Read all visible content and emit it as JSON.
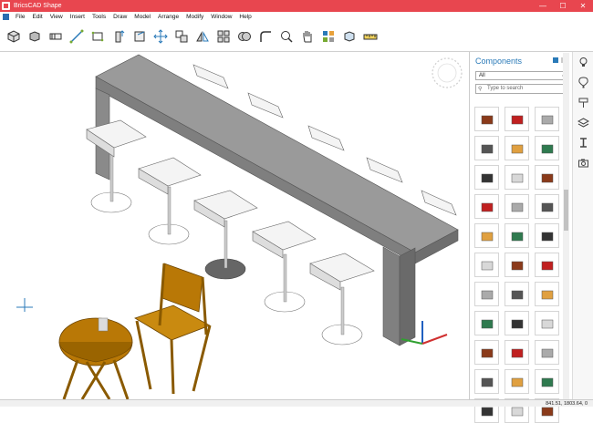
{
  "window": {
    "title": "BricsCAD Shape",
    "minimize": "—",
    "maximize": "☐",
    "close": "✕"
  },
  "menu": [
    "File",
    "Edit",
    "View",
    "Insert",
    "Tools",
    "Draw",
    "Model",
    "Arrange",
    "Modify",
    "Window",
    "Help"
  ],
  "toolbar": {
    "tools": [
      "box-icon",
      "solid-icon",
      "extrude-icon",
      "line-icon",
      "rectangle-icon",
      "push-pull-icon",
      "section-icon",
      "move-icon",
      "copy-icon",
      "mirror-icon",
      "array-icon",
      "union-icon",
      "fillet-icon",
      "zoom-icon",
      "pan-icon",
      "materials-icon",
      "render-icon",
      "measure-icon"
    ]
  },
  "components_panel": {
    "title": "Components",
    "filter_value": "All",
    "search_placeholder": "Type to search",
    "items": [
      "table-item",
      "stove-item",
      "desk-item",
      "office-chair-item",
      "cabinet-item",
      "glass-table-item",
      "bench-item",
      "round-table-item",
      "bed-item",
      "sofa-item",
      "fire-extinguisher-item",
      "clock-item",
      "chair-item",
      "shelf-item",
      "crate-item",
      "lamp-item",
      "kitchen-item",
      "drawer-item",
      "beam-item",
      "wall-item",
      "sideboard-item",
      "frame-item",
      "nightstand-item",
      "laptop-item",
      "board-item",
      "piano-item",
      "pool-table-item",
      "locker-item",
      "sign-item",
      "rug-item",
      "hand-item",
      "lamp2-item",
      "bowl-item"
    ]
  },
  "right_sidebar": [
    "light-bulb-icon",
    "hot-air-balloon-icon",
    "paint-roller-icon",
    "layers-icon",
    "i-beam-icon",
    "camera-icon"
  ],
  "status": {
    "coordinates": "841.51, 1803.64, 0"
  }
}
